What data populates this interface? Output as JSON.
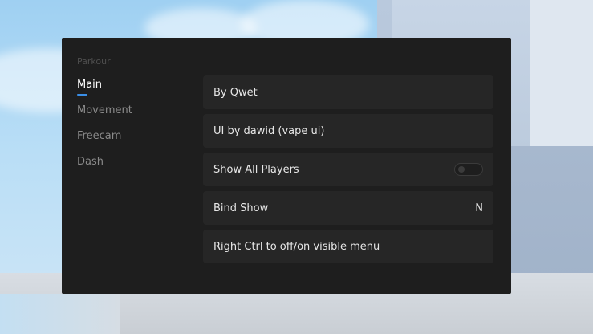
{
  "sidebar": {
    "section_title": "Parkour",
    "items": [
      {
        "label": "Main",
        "active": true
      },
      {
        "label": "Movement",
        "active": false
      },
      {
        "label": "Freecam",
        "active": false
      },
      {
        "label": "Dash",
        "active": false
      }
    ]
  },
  "main": {
    "rows": [
      {
        "label": "By Qwet"
      },
      {
        "label": "UI by dawid (vape ui)"
      },
      {
        "label": "Show All Players",
        "toggle_on": false
      },
      {
        "label": "Bind Show",
        "value": "N"
      },
      {
        "label": "Right Ctrl to off/on visible menu"
      }
    ]
  },
  "colors": {
    "panel_bg": "#1e1e1e",
    "row_bg": "#262626",
    "accent": "#3a8ee6",
    "text_active": "#ffffff",
    "text_inactive": "#8a8a8a",
    "section_title": "#4f4f4f"
  }
}
